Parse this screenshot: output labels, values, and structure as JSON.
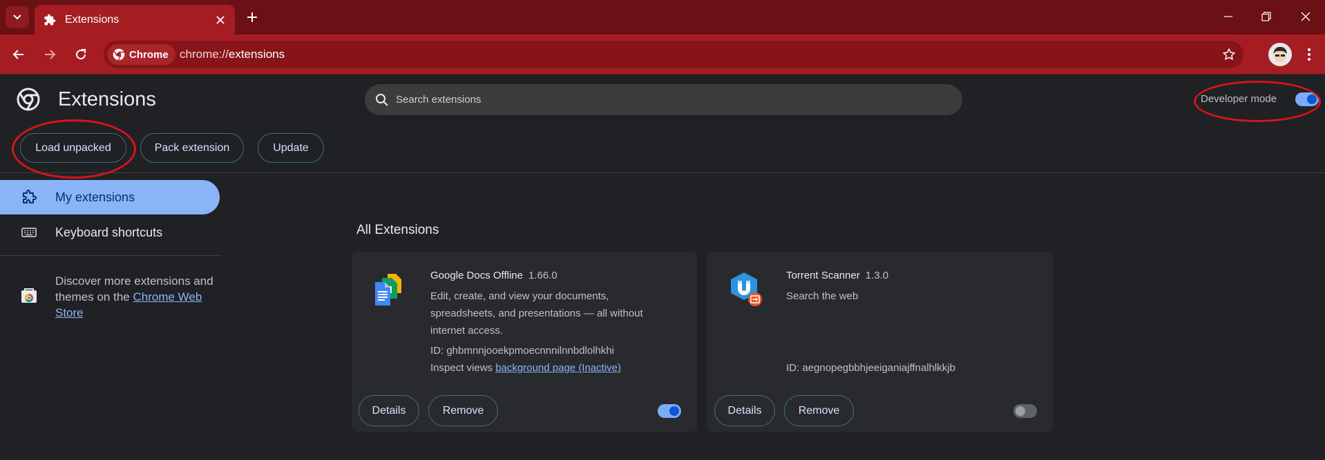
{
  "browser": {
    "tab": {
      "title": "Extensions"
    },
    "omnibox": {
      "site_chip": "Chrome",
      "url_scheme": "chrome://",
      "url_host": "extensions"
    }
  },
  "page": {
    "title": "Extensions",
    "search_placeholder": "Search extensions",
    "developer_mode_label": "Developer mode",
    "developer_mode_on": true,
    "actions": {
      "load_unpacked": "Load unpacked",
      "pack_extension": "Pack extension",
      "update": "Update"
    }
  },
  "sidebar": {
    "items": [
      {
        "label": "My extensions",
        "icon": "extension-icon",
        "active": true
      },
      {
        "label": "Keyboard shortcuts",
        "icon": "keyboard-icon",
        "active": false
      }
    ],
    "promo": {
      "text_before": "Discover more extensions and themes on the ",
      "link": "Chrome Web Store"
    }
  },
  "main": {
    "section_title": "All Extensions",
    "extensions": [
      {
        "name": "Google Docs Offline",
        "version": "1.66.0",
        "description": "Edit, create, and view your documents, spreadsheets, and presentations — all without internet access.",
        "id": "ID: ghbmnnjooekpmoecnnnilnnbdlolhkhi",
        "inspect_label": "Inspect views ",
        "inspect_link": "background page (Inactive)",
        "details": "Details",
        "remove": "Remove",
        "enabled": true
      },
      {
        "name": "Torrent Scanner",
        "version": "1.3.0",
        "description": "Search the web",
        "id": "ID: aegnopegbbhjeeiganiajffnalhlkkjb",
        "details": "Details",
        "remove": "Remove",
        "enabled": false
      }
    ]
  },
  "colors": {
    "titlebar": "#6b1014",
    "toolbar": "#a51d23",
    "background": "#202124",
    "card": "#292a2d",
    "accent": "#8ab4f8",
    "annotation": "#d6141b"
  }
}
